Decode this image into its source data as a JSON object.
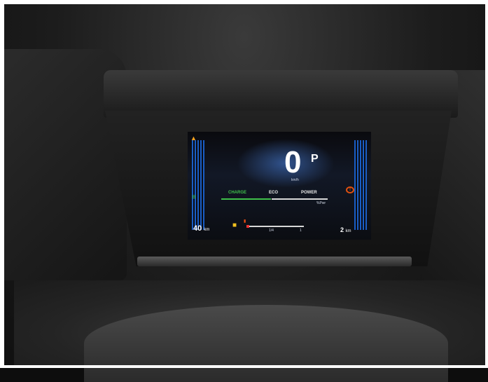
{
  "speed": "0",
  "gear": "P",
  "speed_unit": "km/h",
  "modes": [
    "CHARGE",
    "ECO",
    "POWER"
  ],
  "power_unit": "%Pwr",
  "power_level_fraction": 0.47,
  "range_left": "40",
  "range_left_unit": "km",
  "range_right": "2",
  "range_right_unit": "km",
  "fuel_quarter_label": "1/4",
  "fuel_full_label": "1",
  "fuel_level_fraction": 0.02,
  "icons": {
    "seatbelt": "seatbelt-warning-icon",
    "headlight": "headlight-indicator-icon",
    "parking_brake": "parking-brake-icon",
    "fuel_pump": "fuel-pump-icon",
    "fuel_empty": "fuel-empty-icon"
  },
  "colors": {
    "charge": "#3fc04a",
    "gauge_blue": "#1b66d8",
    "warning_orange": "#e05010",
    "fuel_yellow": "#f0c020"
  }
}
